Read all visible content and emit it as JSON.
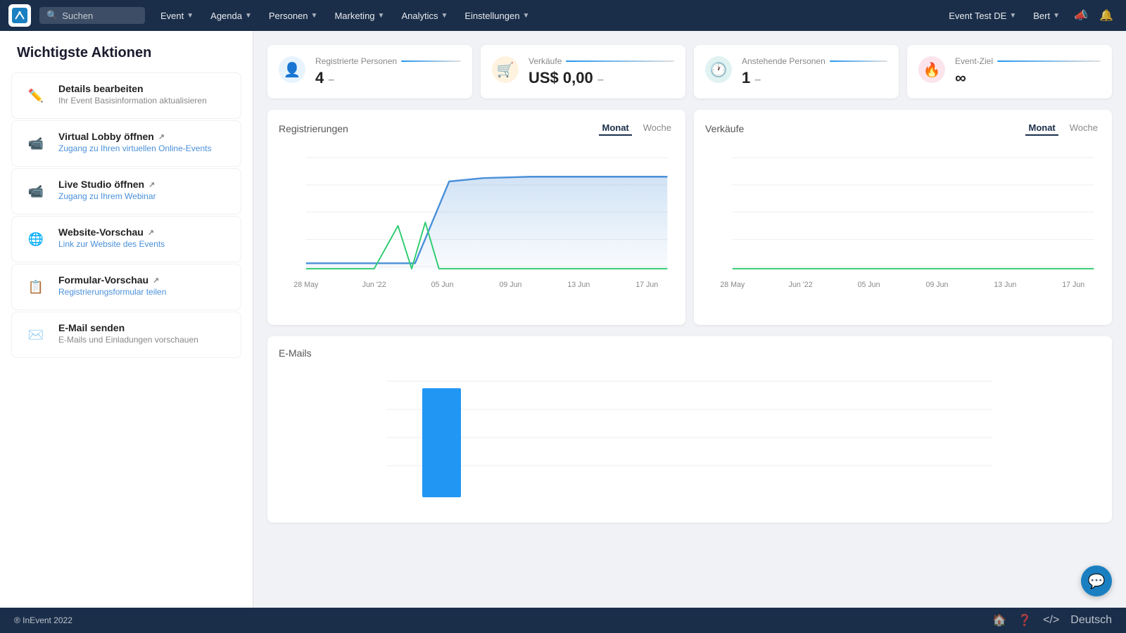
{
  "app": {
    "logo_alt": "InEvent Logo"
  },
  "navbar": {
    "search_placeholder": "Suchen",
    "items": [
      {
        "label": "Event",
        "has_dropdown": true
      },
      {
        "label": "Agenda",
        "has_dropdown": true
      },
      {
        "label": "Personen",
        "has_dropdown": true
      },
      {
        "label": "Marketing",
        "has_dropdown": true
      },
      {
        "label": "Analytics",
        "has_dropdown": true
      },
      {
        "label": "Einstellungen",
        "has_dropdown": true
      }
    ],
    "event_selector": "Event Test DE",
    "user": "Bert"
  },
  "sidebar": {
    "title": "Wichtigste Aktionen",
    "items": [
      {
        "id": "details",
        "label": "Details bearbeiten",
        "subtitle": "Ihr Event Basisinformation aktualisieren",
        "subtitle_colored": false,
        "icon": "✏️"
      },
      {
        "id": "lobby",
        "label": "Virtual Lobby öffnen",
        "subtitle": "Zugang zu Ihren virtuellen Online-Events",
        "subtitle_colored": true,
        "icon": "🎥",
        "external": true
      },
      {
        "id": "studio",
        "label": "Live Studio öffnen",
        "subtitle": "Zugang zu Ihrem Webinar",
        "subtitle_colored": true,
        "icon": "🎬",
        "external": true
      },
      {
        "id": "website",
        "label": "Website-Vorschau",
        "subtitle": "Link zur Website des Events",
        "subtitle_colored": true,
        "icon": "🌐",
        "external": true
      },
      {
        "id": "form",
        "label": "Formular-Vorschau",
        "subtitle": "Registrierungsformular teilen",
        "subtitle_colored": true,
        "icon": "📋",
        "external": true
      },
      {
        "id": "email",
        "label": "E-Mail senden",
        "subtitle": "E-Mails und Einladungen vorschauen",
        "subtitle_colored": false,
        "icon": "✉️"
      }
    ]
  },
  "stats": [
    {
      "id": "registered",
      "label": "Registrierte Personen",
      "value": "4",
      "dash": "–",
      "icon_type": "blue",
      "icon": "👤"
    },
    {
      "id": "sales",
      "label": "Verkäufe",
      "value": "US$ 0,00",
      "dash": "–",
      "icon_type": "orange",
      "icon": "🛒"
    },
    {
      "id": "pending",
      "label": "Anstehende Personen",
      "value": "1",
      "dash": "–",
      "icon_type": "teal",
      "icon": "🕐"
    },
    {
      "id": "goal",
      "label": "Event-Ziel",
      "value": "∞",
      "dash": "",
      "icon_type": "red",
      "icon": "🔥"
    }
  ],
  "registrations_chart": {
    "title": "Registrierungen",
    "tab_month": "Monat",
    "tab_week": "Woche",
    "active_tab": "Monat",
    "x_labels": [
      "28 May",
      "Jun '22",
      "05 Jun",
      "09 Jun",
      "13 Jun",
      "17 Jun"
    ]
  },
  "sales_chart": {
    "title": "Verkäufe",
    "tab_month": "Monat",
    "tab_week": "Woche",
    "active_tab": "Monat",
    "x_labels": [
      "28 May",
      "Jun '22",
      "05 Jun",
      "09 Jun",
      "13 Jun",
      "17 Jun"
    ]
  },
  "email_chart": {
    "title": "E-Mails"
  },
  "footer": {
    "copyright": "® InEvent 2022",
    "language": "Deutsch"
  },
  "chat_button": {
    "label": "💬"
  }
}
